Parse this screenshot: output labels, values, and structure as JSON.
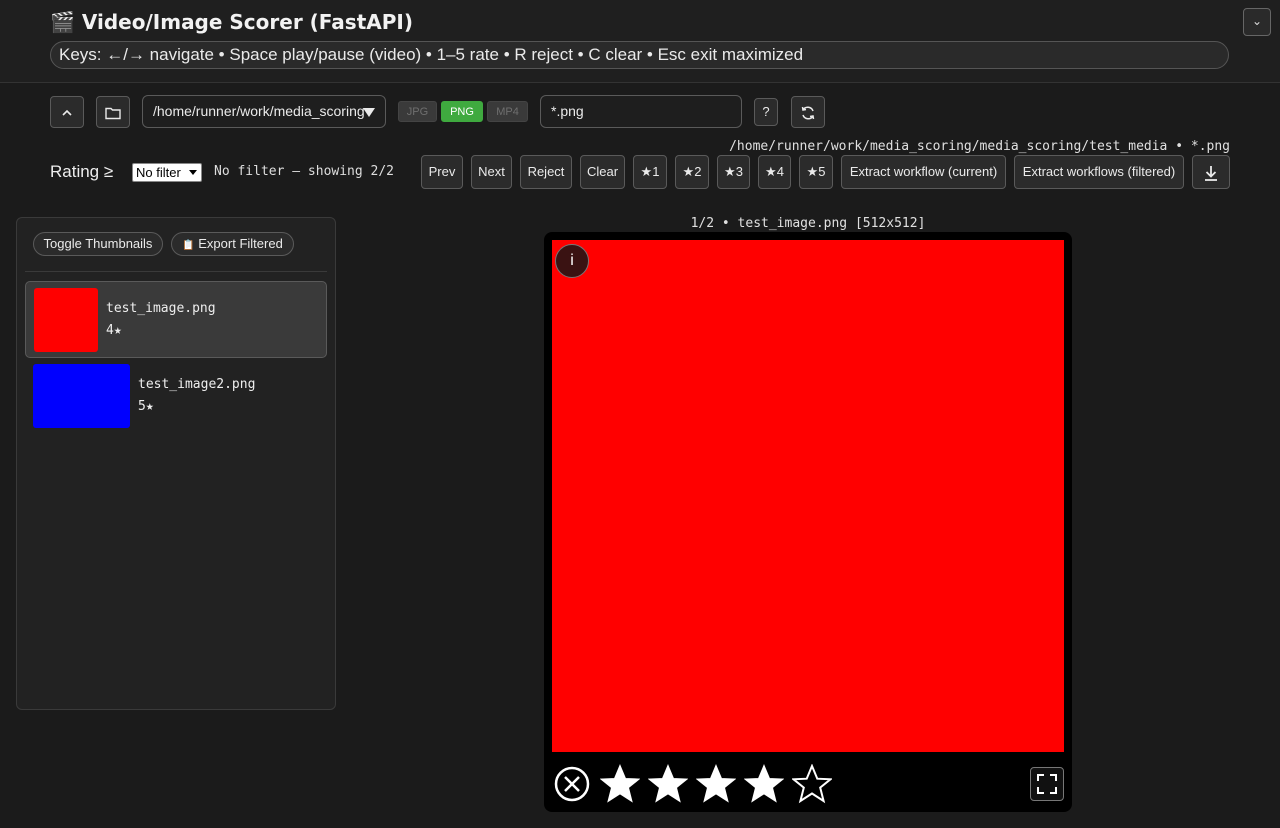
{
  "header": {
    "title_icon": "🎬",
    "title": "Video/Image Scorer (FastAPI)",
    "keys_hint": "Keys: ←/→ navigate • Space play/pause (video) • 1–5 rate • R reject • C clear • Esc exit maximized",
    "collapse_glyph": "⌄"
  },
  "toolbar": {
    "up_icon": "chevron-up-icon",
    "folder_icon": "folder-icon",
    "directory": "/home/runner/work/media_scoring",
    "extensions": [
      {
        "label": "JPG",
        "active": false
      },
      {
        "label": "PNG",
        "active": true
      },
      {
        "label": "MP4",
        "active": false
      }
    ],
    "pattern": "*.png",
    "help_label": "?",
    "refresh_icon": "refresh-icon",
    "path_status": "/home/runner/work/media_scoring/media_scoring/test_media • *.png"
  },
  "filter": {
    "label": "Rating ≥",
    "selected": "No filter",
    "status": "No filter — showing 2/2"
  },
  "actions": {
    "prev": "Prev",
    "next": "Next",
    "reject": "Reject",
    "clear": "Clear",
    "star1": "★1",
    "star2": "★2",
    "star3": "★3",
    "star4": "★4",
    "star5": "★5",
    "extract_current": "Extract workflow (current)",
    "extract_filtered": "Extract workflows (filtered)",
    "download_icon": "download-icon"
  },
  "sidebar": {
    "toggle_thumbnails": "Toggle Thumbnails",
    "export_filtered": "Export Filtered",
    "export_icon": "📋",
    "items": [
      {
        "name": "test_image.png",
        "stars": "4★",
        "color": "#ff0000",
        "selected": true
      },
      {
        "name": "test_image2.png",
        "stars": "5★",
        "color": "#0000ff",
        "selected": false
      }
    ]
  },
  "viewer": {
    "caption": "1/2 • test_image.png [512x512]",
    "info_label": "i",
    "media_color": "#ff0000",
    "rating": 4,
    "max_rating": 5
  }
}
